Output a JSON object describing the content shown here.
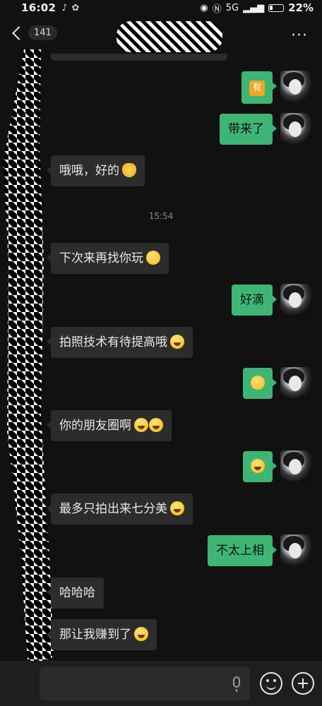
{
  "status_bar": {
    "time": "16:02",
    "battery_percent": "22%",
    "signal_text": "5G"
  },
  "header": {
    "unread_count": "141",
    "title": ""
  },
  "timestamp": "15:54",
  "messages": [
    {
      "side": "out",
      "text": "",
      "emoji": "有"
    },
    {
      "side": "out",
      "text": "带来了"
    },
    {
      "side": "in",
      "text": "哦哦，好的",
      "emoji": "ok-hand"
    },
    {
      "side": "in",
      "text": "下次来再找你玩",
      "emoji": "smile"
    },
    {
      "side": "out",
      "text": "好滴"
    },
    {
      "side": "in",
      "text": "拍照技术有待提高哦",
      "emoji": "cheeky"
    },
    {
      "side": "out",
      "text": "",
      "emoji": "sticker"
    },
    {
      "side": "in",
      "text": "你的朋友圈啊",
      "emoji": "tears-of-joy-x2"
    },
    {
      "side": "out",
      "text": "",
      "emoji": "sticker"
    },
    {
      "side": "in",
      "text": "最多只拍出来七分美",
      "emoji": "cheeky"
    },
    {
      "side": "out",
      "text": "不太上相"
    },
    {
      "side": "in",
      "text": "哈哈哈"
    },
    {
      "side": "in",
      "text": "那让我赚到了",
      "emoji": "tears-of-joy"
    }
  ],
  "colors": {
    "background": "#111111",
    "incoming_bubble": "#2c2c2c",
    "outgoing_bubble": "#3eb575"
  }
}
